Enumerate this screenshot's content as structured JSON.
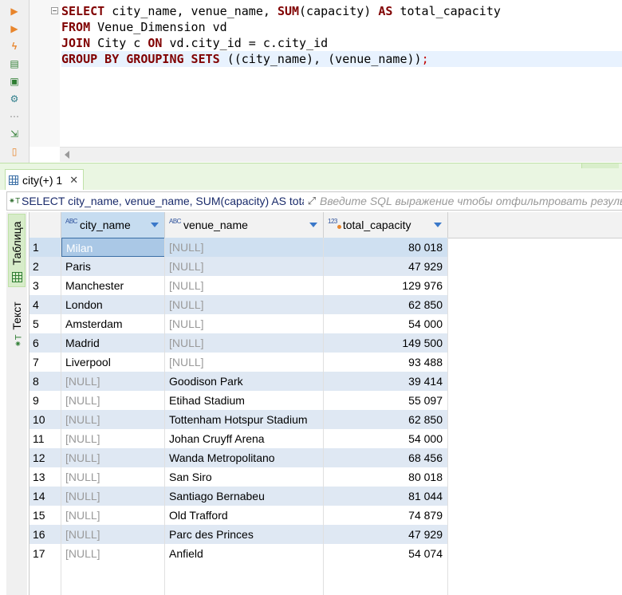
{
  "editor": {
    "lines": [
      [
        {
          "t": "SELECT",
          "k": "kw"
        },
        {
          "t": " city_name, venue_name, ",
          "k": "pl"
        },
        {
          "t": "SUM",
          "k": "kw"
        },
        {
          "t": "(capacity) ",
          "k": "pl"
        },
        {
          "t": "AS",
          "k": "kw"
        },
        {
          "t": " total_capacity",
          "k": "pl"
        }
      ],
      [
        {
          "t": "FROM",
          "k": "kw"
        },
        {
          "t": " Venue_Dimension vd",
          "k": "pl"
        }
      ],
      [
        {
          "t": "JOIN",
          "k": "kw"
        },
        {
          "t": " City c ",
          "k": "pl"
        },
        {
          "t": "ON",
          "k": "kw"
        },
        {
          "t": " vd.city_id = c.city_id",
          "k": "pl"
        }
      ],
      [
        {
          "t": "GROUP BY GROUPING SETS",
          "k": "kw"
        },
        {
          "t": " ((city_name), (venue_name))",
          "k": "pl"
        },
        {
          "t": ";",
          "k": "red"
        }
      ]
    ]
  },
  "results_tab": {
    "label": "city(+) 1",
    "close": "✕"
  },
  "filter": {
    "query": "SELECT city_name, venue_name, SUM(capacity) AS total_capacity",
    "placeholder": "Введите SQL выражение чтобы отфильтровать результаты"
  },
  "side_tabs": {
    "table": "Таблица",
    "text": "Текст"
  },
  "columns": [
    {
      "name": "city_name",
      "type": "ABC"
    },
    {
      "name": "venue_name",
      "type": "ABC"
    },
    {
      "name": "total_capacity",
      "type": "123"
    }
  ],
  "rows": [
    [
      "1",
      "Milan",
      "[NULL]",
      "80 018"
    ],
    [
      "2",
      "Paris",
      "[NULL]",
      "47 929"
    ],
    [
      "3",
      "Manchester",
      "[NULL]",
      "129 976"
    ],
    [
      "4",
      "London",
      "[NULL]",
      "62 850"
    ],
    [
      "5",
      "Amsterdam",
      "[NULL]",
      "54 000"
    ],
    [
      "6",
      "Madrid",
      "[NULL]",
      "149 500"
    ],
    [
      "7",
      "Liverpool",
      "[NULL]",
      "93 488"
    ],
    [
      "8",
      "[NULL]",
      "Goodison Park",
      "39 414"
    ],
    [
      "9",
      "[NULL]",
      "Etihad Stadium",
      "55 097"
    ],
    [
      "10",
      "[NULL]",
      "Tottenham Hotspur Stadium",
      "62 850"
    ],
    [
      "11",
      "[NULL]",
      "Johan Cruyff Arena",
      "54 000"
    ],
    [
      "12",
      "[NULL]",
      "Wanda Metropolitano",
      "68 456"
    ],
    [
      "13",
      "[NULL]",
      "San Siro",
      "80 018"
    ],
    [
      "14",
      "[NULL]",
      "Santiago Bernabeu",
      "81 044"
    ],
    [
      "15",
      "[NULL]",
      "Old Trafford",
      "74 879"
    ],
    [
      "16",
      "[NULL]",
      "Parc des Princes",
      "47 929"
    ],
    [
      "17",
      "[NULL]",
      "Anfield",
      "54 074"
    ]
  ],
  "colors": {
    "keyword": "#800000",
    "null_text": "#9a9a9a",
    "alt_row": "#dfe8f3",
    "accent_green": "#d7ecc9"
  },
  "icons": [
    "execute-icon",
    "execute-script-icon",
    "explain-icon",
    "load-icon",
    "console-icon",
    "settings-icon",
    "more-icon",
    "export-icon",
    "new-script-icon",
    "grid-icon",
    "close-icon",
    "filter-icon",
    "expand-icon",
    "table-view-icon",
    "text-view-icon",
    "sort-icon"
  ]
}
